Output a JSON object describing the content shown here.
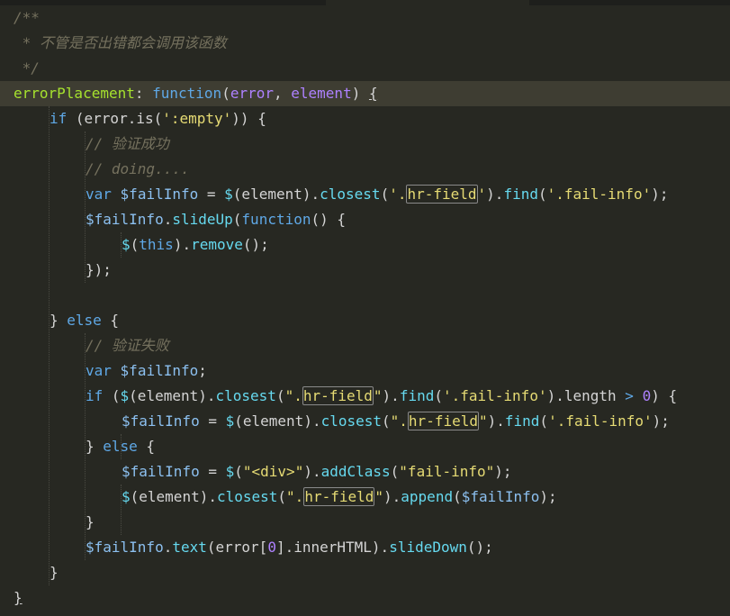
{
  "editor": {
    "lines": [
      {
        "indent": 0,
        "tokens": [
          {
            "t": "/**",
            "c": "cm"
          }
        ]
      },
      {
        "indent": 0,
        "tokens": [
          {
            "t": " * 不管是否出错都会调用该函数",
            "c": "cm"
          }
        ]
      },
      {
        "indent": 0,
        "tokens": [
          {
            "t": " */",
            "c": "cm"
          }
        ]
      },
      {
        "indent": 0,
        "current": true,
        "tokens": [
          {
            "t": "errorPlacement",
            "c": "pr"
          },
          {
            "t": ": ",
            "c": "pl"
          },
          {
            "t": "function",
            "c": "kw"
          },
          {
            "t": "(",
            "c": "pl"
          },
          {
            "t": "error",
            "c": "pa"
          },
          {
            "t": ", ",
            "c": "pl"
          },
          {
            "t": "element",
            "c": "pa"
          },
          {
            "t": ") ",
            "c": "pl"
          },
          {
            "t": "{",
            "c": "pl brace"
          }
        ]
      },
      {
        "indent": 1,
        "tokens": [
          {
            "t": "if",
            "c": "kw"
          },
          {
            "t": " (error.is(",
            "c": "pl"
          },
          {
            "t": "':empty'",
            "c": "st"
          },
          {
            "t": ")) {",
            "c": "pl"
          }
        ]
      },
      {
        "indent": 2,
        "tokens": [
          {
            "t": "// 验证成功",
            "c": "cm"
          }
        ]
      },
      {
        "indent": 2,
        "tokens": [
          {
            "t": "// doing....",
            "c": "cm"
          }
        ]
      },
      {
        "indent": 2,
        "tokens": [
          {
            "t": "var",
            "c": "kw"
          },
          {
            "t": " ",
            "c": "pl"
          },
          {
            "t": "$failInfo",
            "c": "va"
          },
          {
            "t": " = ",
            "c": "pl"
          },
          {
            "t": "$",
            "c": "fn"
          },
          {
            "t": "(element).",
            "c": "pl"
          },
          {
            "t": "closest",
            "c": "fn"
          },
          {
            "t": "(",
            "c": "pl"
          },
          {
            "t": "'.",
            "c": "st"
          },
          {
            "t": "hr-field",
            "c": "st hl"
          },
          {
            "t": "'",
            "c": "st"
          },
          {
            "t": ").",
            "c": "pl"
          },
          {
            "t": "find",
            "c": "fn"
          },
          {
            "t": "(",
            "c": "pl"
          },
          {
            "t": "'.fail-info'",
            "c": "st"
          },
          {
            "t": ");",
            "c": "pl"
          }
        ]
      },
      {
        "indent": 2,
        "tokens": [
          {
            "t": "$failInfo",
            "c": "va"
          },
          {
            "t": ".",
            "c": "pl"
          },
          {
            "t": "slideUp",
            "c": "fn"
          },
          {
            "t": "(",
            "c": "pl"
          },
          {
            "t": "function",
            "c": "kw"
          },
          {
            "t": "() {",
            "c": "pl"
          }
        ]
      },
      {
        "indent": 3,
        "tokens": [
          {
            "t": "$",
            "c": "fn"
          },
          {
            "t": "(",
            "c": "pl"
          },
          {
            "t": "this",
            "c": "kw"
          },
          {
            "t": ").",
            "c": "pl"
          },
          {
            "t": "remove",
            "c": "fn"
          },
          {
            "t": "();",
            "c": "pl"
          }
        ]
      },
      {
        "indent": 2,
        "tokens": [
          {
            "t": "});",
            "c": "pl"
          }
        ]
      },
      {
        "indent": 0,
        "tokens": []
      },
      {
        "indent": 1,
        "tokens": [
          {
            "t": "} ",
            "c": "pl"
          },
          {
            "t": "else",
            "c": "kw"
          },
          {
            "t": " {",
            "c": "pl"
          }
        ]
      },
      {
        "indent": 2,
        "tokens": [
          {
            "t": "// 验证失败",
            "c": "cm"
          }
        ]
      },
      {
        "indent": 2,
        "tokens": [
          {
            "t": "var",
            "c": "kw"
          },
          {
            "t": " ",
            "c": "pl"
          },
          {
            "t": "$failInfo",
            "c": "va"
          },
          {
            "t": ";",
            "c": "pl"
          }
        ]
      },
      {
        "indent": 2,
        "tokens": [
          {
            "t": "if",
            "c": "kw"
          },
          {
            "t": " (",
            "c": "pl"
          },
          {
            "t": "$",
            "c": "fn"
          },
          {
            "t": "(element).",
            "c": "pl"
          },
          {
            "t": "closest",
            "c": "fn"
          },
          {
            "t": "(",
            "c": "pl"
          },
          {
            "t": "\".",
            "c": "st"
          },
          {
            "t": "hr-field",
            "c": "st hl"
          },
          {
            "t": "\"",
            "c": "st"
          },
          {
            "t": ").",
            "c": "pl"
          },
          {
            "t": "find",
            "c": "fn"
          },
          {
            "t": "(",
            "c": "pl"
          },
          {
            "t": "'.fail-info'",
            "c": "st"
          },
          {
            "t": ").length ",
            "c": "pl"
          },
          {
            "t": ">",
            "c": "kw"
          },
          {
            "t": " ",
            "c": "pl"
          },
          {
            "t": "0",
            "c": "nu"
          },
          {
            "t": ") {",
            "c": "pl"
          }
        ]
      },
      {
        "indent": 3,
        "tokens": [
          {
            "t": "$failInfo",
            "c": "va"
          },
          {
            "t": " = ",
            "c": "pl"
          },
          {
            "t": "$",
            "c": "fn"
          },
          {
            "t": "(element).",
            "c": "pl"
          },
          {
            "t": "closest",
            "c": "fn"
          },
          {
            "t": "(",
            "c": "pl"
          },
          {
            "t": "\".",
            "c": "st"
          },
          {
            "t": "hr-field",
            "c": "st hl"
          },
          {
            "t": "\"",
            "c": "st"
          },
          {
            "t": ").",
            "c": "pl"
          },
          {
            "t": "find",
            "c": "fn"
          },
          {
            "t": "(",
            "c": "pl"
          },
          {
            "t": "'.fail-info'",
            "c": "st"
          },
          {
            "t": ");",
            "c": "pl"
          }
        ]
      },
      {
        "indent": 2,
        "tokens": [
          {
            "t": "} ",
            "c": "pl"
          },
          {
            "t": "else",
            "c": "kw"
          },
          {
            "t": " {",
            "c": "pl"
          }
        ]
      },
      {
        "indent": 3,
        "tokens": [
          {
            "t": "$failInfo",
            "c": "va"
          },
          {
            "t": " = ",
            "c": "pl"
          },
          {
            "t": "$",
            "c": "fn"
          },
          {
            "t": "(",
            "c": "pl"
          },
          {
            "t": "\"<div>\"",
            "c": "st"
          },
          {
            "t": ").",
            "c": "pl"
          },
          {
            "t": "addClass",
            "c": "fn"
          },
          {
            "t": "(",
            "c": "pl"
          },
          {
            "t": "\"fail-info\"",
            "c": "st"
          },
          {
            "t": ");",
            "c": "pl"
          }
        ]
      },
      {
        "indent": 3,
        "tokens": [
          {
            "t": "$",
            "c": "fn"
          },
          {
            "t": "(element).",
            "c": "pl"
          },
          {
            "t": "closest",
            "c": "fn"
          },
          {
            "t": "(",
            "c": "pl"
          },
          {
            "t": "\".",
            "c": "st"
          },
          {
            "t": "hr-field",
            "c": "st hl"
          },
          {
            "t": "\"",
            "c": "st"
          },
          {
            "t": ").",
            "c": "pl"
          },
          {
            "t": "append",
            "c": "fn"
          },
          {
            "t": "(",
            "c": "pl"
          },
          {
            "t": "$failInfo",
            "c": "va"
          },
          {
            "t": ");",
            "c": "pl"
          }
        ]
      },
      {
        "indent": 2,
        "tokens": [
          {
            "t": "}",
            "c": "pl"
          }
        ]
      },
      {
        "indent": 2,
        "tokens": [
          {
            "t": "$failInfo",
            "c": "va"
          },
          {
            "t": ".",
            "c": "pl"
          },
          {
            "t": "text",
            "c": "fn"
          },
          {
            "t": "(error[",
            "c": "pl"
          },
          {
            "t": "0",
            "c": "nu"
          },
          {
            "t": "].innerHTML).",
            "c": "pl"
          },
          {
            "t": "slideDown",
            "c": "fn"
          },
          {
            "t": "();",
            "c": "pl"
          }
        ]
      },
      {
        "indent": 1,
        "tokens": [
          {
            "t": "}",
            "c": "pl"
          }
        ]
      },
      {
        "indent": 0,
        "tokens": [
          {
            "t": "}",
            "c": "pl brace"
          }
        ]
      }
    ]
  },
  "theme": {
    "background": "#272822",
    "current_line": "#3e3d32",
    "comment": "#75715e",
    "keyword": "#5fa8e6",
    "function": "#66d9ef",
    "parameter": "#ae81ff",
    "string": "#e6db74",
    "property": "#a6e22e"
  }
}
